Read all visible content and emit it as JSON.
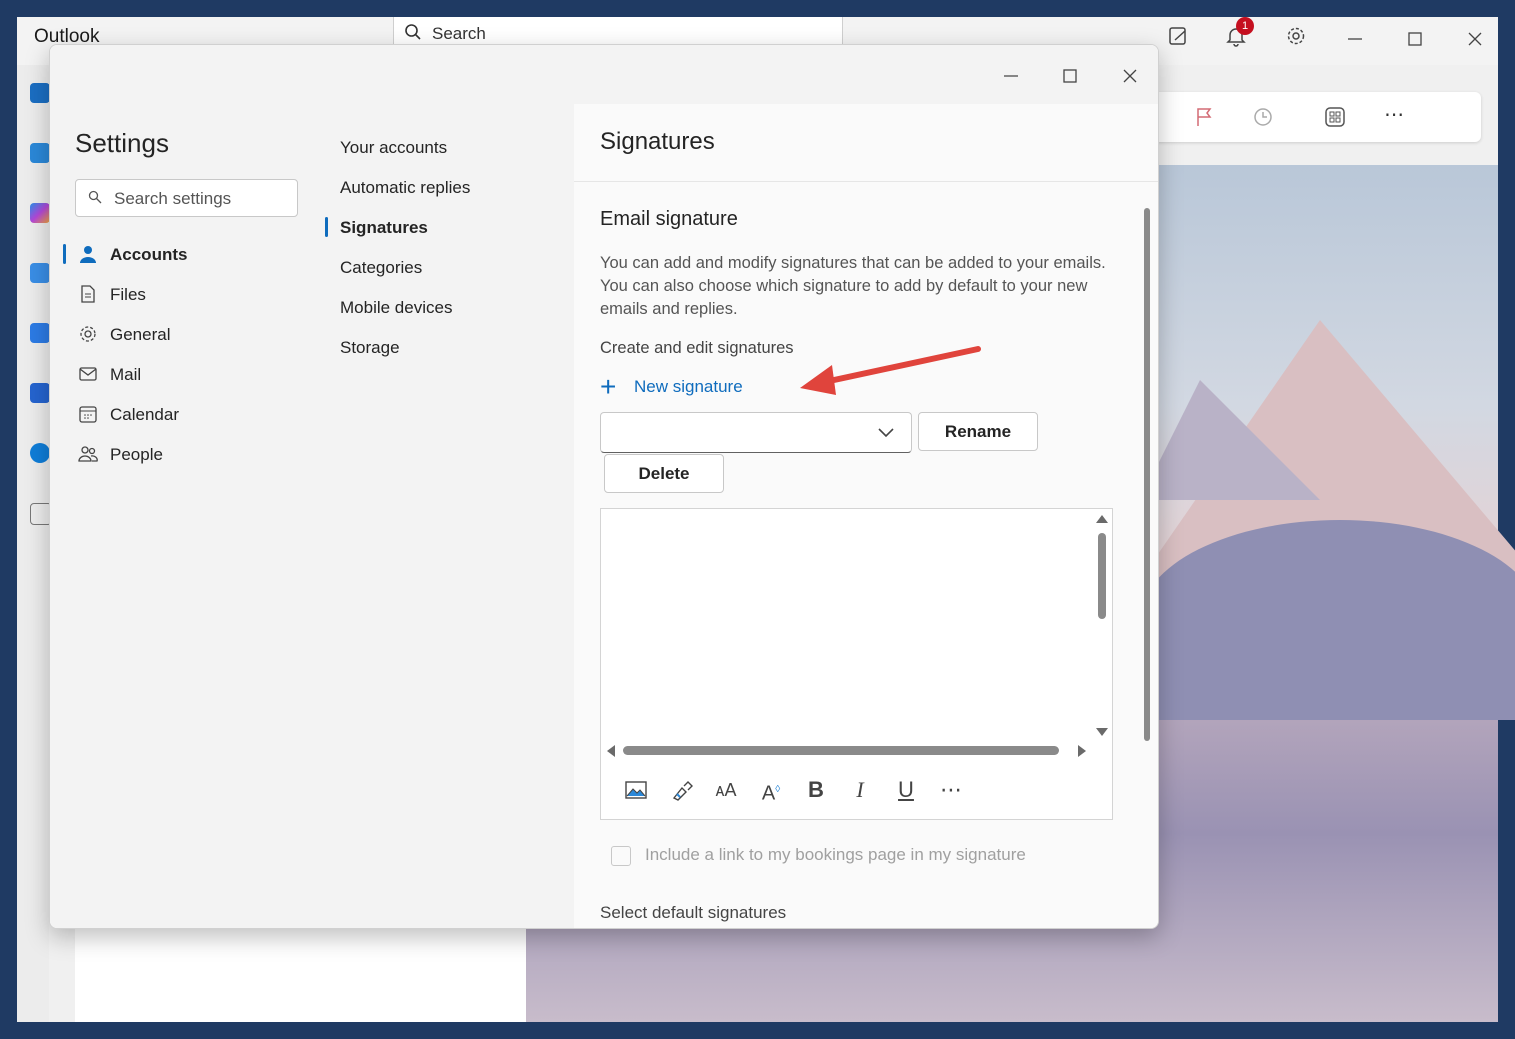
{
  "app": {
    "name": "Outlook",
    "search_placeholder": "Search",
    "notification_count": "1"
  },
  "dialog": {
    "settings_title": "Settings",
    "search_placeholder": "Search settings",
    "categories": [
      {
        "label": "Accounts",
        "icon": "person-icon",
        "active": true
      },
      {
        "label": "Files",
        "icon": "file-icon"
      },
      {
        "label": "General",
        "icon": "gear-icon"
      },
      {
        "label": "Mail",
        "icon": "mail-icon"
      },
      {
        "label": "Calendar",
        "icon": "calendar-icon"
      },
      {
        "label": "People",
        "icon": "people-icon"
      }
    ],
    "subnav": [
      {
        "label": "Your accounts"
      },
      {
        "label": "Automatic replies"
      },
      {
        "label": "Signatures",
        "active": true
      },
      {
        "label": "Categories"
      },
      {
        "label": "Mobile devices"
      },
      {
        "label": "Storage"
      }
    ],
    "pane_title": "Signatures",
    "email_signature": {
      "title": "Email signature",
      "description": "You can add and modify signatures that can be added to your emails. You can also choose which signature to add by default to your new emails and replies.",
      "create_edit_label": "Create and edit signatures",
      "new_signature_label": "New signature",
      "selected_signature": "",
      "rename_label": "Rename",
      "delete_label": "Delete",
      "formatting_tools": [
        "insert-picture-icon",
        "format-painter-icon",
        "font-size-icon",
        "text-effects-icon",
        "bold-icon",
        "italic-icon",
        "underline-icon",
        "more-options-icon"
      ],
      "bookings_checkbox_label": "Include a link to my bookings page in my signature",
      "bookings_checked": false,
      "select_default_label": "Select default signatures"
    }
  },
  "colors": {
    "accent": "#0f6cbd",
    "annotation_arrow": "#e0443c",
    "frame": "#1f3a63"
  }
}
